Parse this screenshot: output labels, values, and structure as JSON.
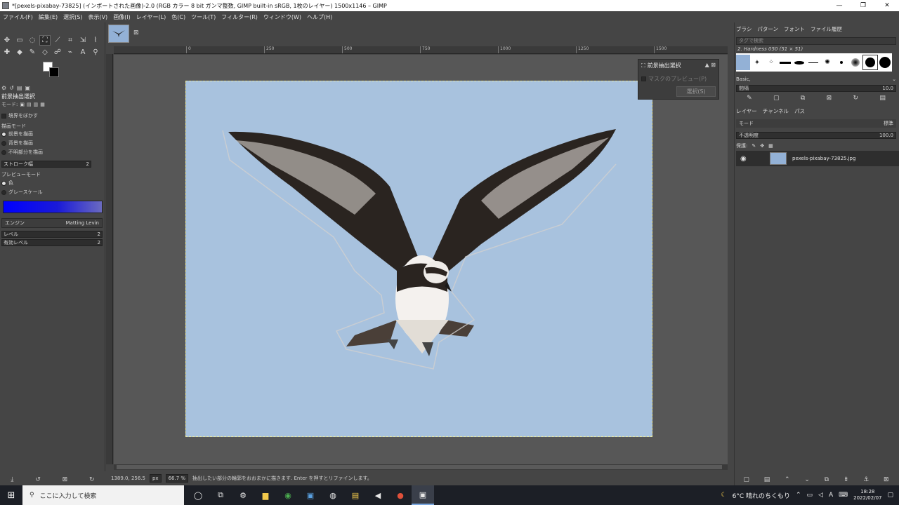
{
  "window": {
    "title": "*[pexels-pixabay-73825] (インポートされた画像)-2.0 (RGB カラー 8 bit ガンマ整数, GIMP built-in sRGB, 1枚のレイヤー) 1500x1146 – GIMP",
    "minimize": "—",
    "restore": "❐",
    "close": "✕"
  },
  "menu": [
    "ファイル(F)",
    "編集(E)",
    "選択(S)",
    "表示(V)",
    "画像(I)",
    "レイヤー(L)",
    "色(C)",
    "ツール(T)",
    "フィルター(R)",
    "ウィンドウ(W)",
    "ヘルプ(H)"
  ],
  "tool_options": {
    "title": "前景抽出選択",
    "mode_label": "モード:",
    "feather": "境界をぼかす",
    "draw_mode_label": "描画モード",
    "draw_modes": [
      "前景を描画",
      "背景を描画",
      "不明部分を描画"
    ],
    "stroke_label": "ストローク幅",
    "stroke_value": "2",
    "preview_mode_label": "プレビューモード",
    "preview_modes": [
      "色",
      "グレースケール"
    ],
    "engine_label": "エンジン",
    "engine_value": "Matting Levin",
    "levels_label": "レベル",
    "levels_value": "2",
    "active_levels_label": "有効レベル",
    "active_levels_value": "2",
    "preview_color": "#0000ff"
  },
  "ruler": {
    "h_ticks": [
      "0",
      "250",
      "500",
      "750",
      "1000",
      "1250",
      "1500"
    ]
  },
  "fg_dialog": {
    "title": "前景抽出選択",
    "preview": "マスクのプレビュー(P)",
    "select": "選択(S)"
  },
  "status": {
    "coords": "1389.0, 256.5",
    "unit": "px",
    "zoom": "66.7 %",
    "message": "抽出したい部分の輪郭をおおまかに描きます. Enter を押すとリファインします。"
  },
  "dock": {
    "tabs": [
      "ブラシ",
      "パターン",
      "フォント",
      "ファイル履歴"
    ],
    "tag_placeholder": "タグで検索",
    "brush_name": "2. Hardness 050 (51 × 51)",
    "preset": "Basic,",
    "spacing_label": "間隔",
    "spacing_value": "10.0",
    "layer_tabs": [
      "レイヤー",
      "チャンネル",
      "パス"
    ],
    "mode_label": "モード",
    "mode_value": "標準",
    "opacity_label": "不透明度",
    "opacity_value": "100.0",
    "lock_label": "保護:",
    "layer_name": "pexels-pixabay-73825.jpg"
  },
  "taskbar": {
    "search_placeholder": "ここに入力して検索",
    "weather": "6°C 晴れのちくもり",
    "ime": "A",
    "time": "18:28",
    "date": "2022/02/07"
  },
  "colors": {
    "sky": "#a8c2de",
    "ui_bg": "#454545",
    "canvas_bg": "#575757"
  }
}
